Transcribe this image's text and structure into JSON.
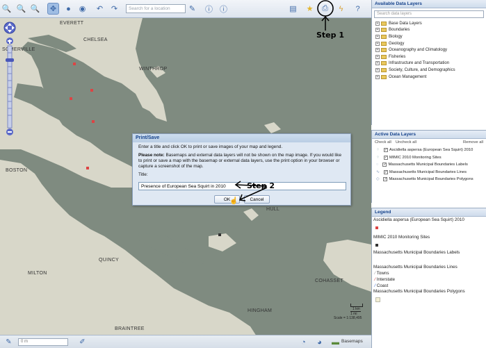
{
  "toolbar": {
    "search_placeholder": "Search for a location",
    "step1_label": "Step 1"
  },
  "map": {
    "places": [
      "EVERETT",
      "CHELSEA",
      "SOMERVILLE",
      "WINTHROP",
      "BOSTON",
      "QUINCY",
      "MILTON",
      "COHASSET",
      "HINGHAM",
      "BRAINTREE",
      "HULL"
    ],
    "scale_text": "Scale = 1:138,495",
    "scale_km": "1 km",
    "scale_mi": "1 mi"
  },
  "dialog": {
    "title": "Print/Save",
    "instruction": "Enter a title and click OK to print or save images of your map and legend.",
    "note_bold": "Please note:",
    "note_text": "Basemaps and external data layers will not be shown on the map image. If you would like to print or save a map with the basemap or external data layers, use the print option in your browser or capture a screenshot of the map.",
    "title_label": "Title:",
    "title_value": "Presence of European Sea Squirt in 2010",
    "ok_label": "OK",
    "cancel_label": "Cancel",
    "step2_label": "Step 2"
  },
  "bottombar": {
    "coord_value": "0 m",
    "basemaps_label": "Basemaps"
  },
  "available_layers": {
    "header": "Available Data Layers",
    "search_placeholder": "Search data layers",
    "items": [
      "Base Data Layers",
      "Boundaries",
      "Biology",
      "Geology",
      "Oceanography and Climatology",
      "Fisheries",
      "Infrastructure and Transportation",
      "Society, Culture, and Demographics",
      "Ocean Management"
    ]
  },
  "active_layers": {
    "header": "Active Data Layers",
    "check_all": "Check all",
    "uncheck_all": "Uncheck all",
    "remove_all": "Remove all",
    "items": [
      "Ascidiella aspersa (European Sea Squirt) 2010",
      "MIMIC 2010 Monitoring Sites",
      "Massachusetts Municipal Boundaries Labels",
      "Massachusetts Municipal Boundaries Lines",
      "Massachusetts Municipal Boundaries Polygons"
    ]
  },
  "legend": {
    "header": "Legend",
    "entries": [
      "Ascidiella aspersa (European Sea Squirt) 2010",
      "MIMIC 2010 Monitoring Sites",
      "Massachusetts Municipal Boundaries Labels",
      "Massachusetts Municipal Boundaries Lines",
      "Massachusetts Municipal Boundaries Polygons"
    ],
    "line_items": [
      "Towns",
      "Interstate",
      "Coast"
    ]
  },
  "colors": {
    "water": "#7f8b80",
    "land": "#d8d7c9",
    "accent": "#15428b"
  }
}
